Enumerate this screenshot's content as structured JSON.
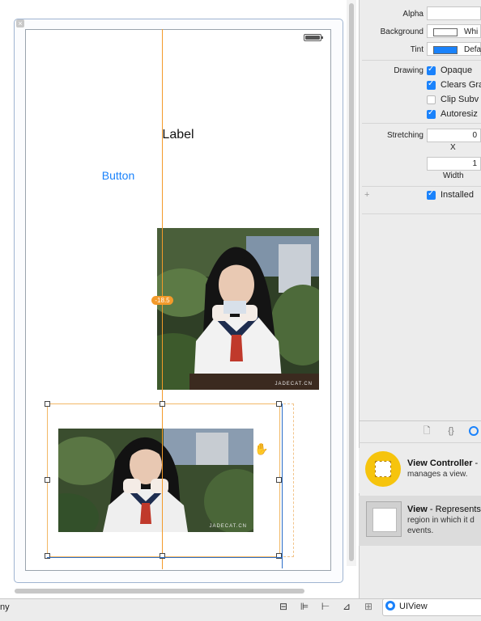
{
  "canvas": {
    "label_text": "Label",
    "button_text": "Button",
    "constraint_value": "-18.5",
    "watermark": "JADECAT.CN"
  },
  "inspector": {
    "alpha_label": "Alpha",
    "background_label": "Background",
    "background_value": "Whi",
    "tint_label": "Tint",
    "tint_value": "Defa",
    "drawing_label": "Drawing",
    "opaque": "Opaque",
    "clears": "Clears Gra",
    "clip": "Clip Subv",
    "autoresize": "Autoresiz",
    "stretching_label": "Stretching",
    "stretch_x_value": "0",
    "stretch_x_label": "X",
    "stretch_w_value": "1",
    "stretch_w_label": "Width",
    "plus": "+",
    "installed": "Installed"
  },
  "library": {
    "vc_title": "View Controller",
    "vc_title_suffix": " -",
    "vc_desc": "manages a view.",
    "view_title": "View",
    "view_desc_1": " - Represents",
    "view_desc_2": "region in which it d",
    "view_desc_3": "events."
  },
  "bottom": {
    "left_text": "ny",
    "class_name": "UIView"
  },
  "colors": {
    "accent": "#1a82fb",
    "guide": "#f39a2a",
    "vc_icon": "#f6c40d"
  }
}
